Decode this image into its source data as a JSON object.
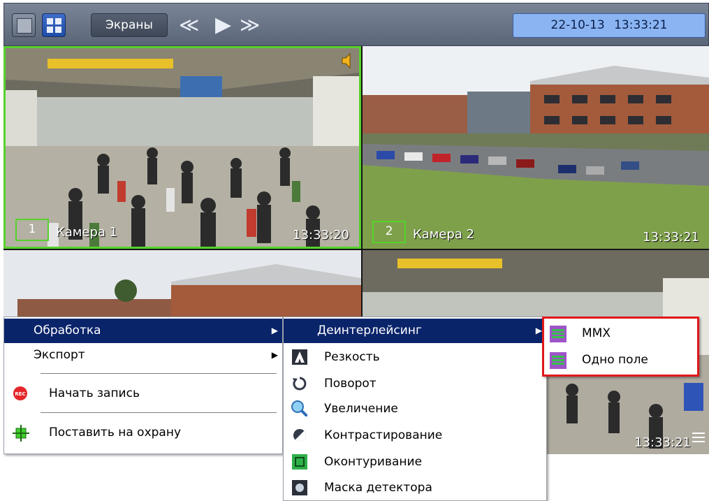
{
  "toolbar": {
    "screens_label": "Экраны",
    "rewind_glyph": "≪",
    "play_glyph": "▶",
    "forward_glyph": "≫",
    "date": "22-10-13",
    "time": "13:33:21"
  },
  "cameras": [
    {
      "number": "1",
      "name": "Камера 1",
      "time": "13:33:20"
    },
    {
      "number": "2",
      "name": "Камера 2",
      "time": "13:33:21"
    },
    {
      "time": "13:33:21"
    }
  ],
  "context_menu": {
    "items": [
      {
        "label": "Обработка",
        "submenu": true
      },
      {
        "label": "Экспорт",
        "submenu": true
      },
      {
        "label": "Начать запись",
        "icon": "record-icon"
      },
      {
        "label": "Поставить на охрану",
        "icon": "arm-icon"
      }
    ]
  },
  "processing_menu": {
    "items": [
      {
        "label": "Деинтерлейсинг",
        "submenu": true
      },
      {
        "label": "Резкость",
        "icon": "sharpness-icon"
      },
      {
        "label": "Поворот",
        "icon": "rotate-icon"
      },
      {
        "label": "Увеличение",
        "icon": "zoom-icon"
      },
      {
        "label": "Контрастирование",
        "icon": "contrast-icon"
      },
      {
        "label": "Оконтуривание",
        "icon": "contour-icon"
      },
      {
        "label": "Маска детектора",
        "icon": "detector-mask-icon"
      }
    ]
  },
  "deinterlace_menu": {
    "items": [
      {
        "label": "MMX",
        "icon": "deinterlace-icon"
      },
      {
        "label": "Одно поле",
        "icon": "deinterlace-icon"
      }
    ]
  },
  "colors": {
    "active_border": "#56d22b",
    "menu_highlight": "#0a246a",
    "highlight_frame": "#e0181b"
  }
}
